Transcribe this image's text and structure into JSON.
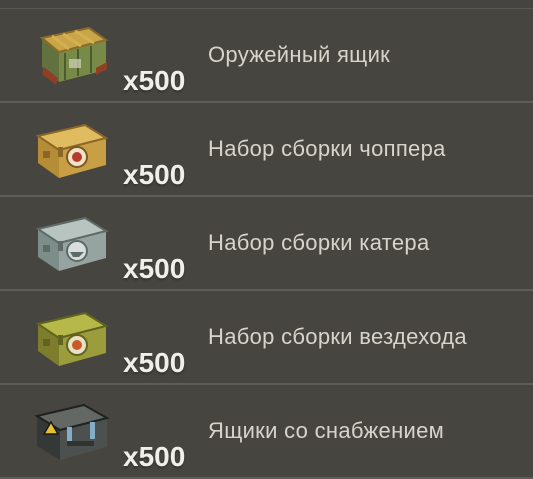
{
  "items": [
    {
      "name": "Оружейный ящик",
      "quantity": "x500",
      "icon": "weapon-crate-icon"
    },
    {
      "name": "Набор сборки чоппера",
      "quantity": "x500",
      "icon": "chopper-kit-box-icon"
    },
    {
      "name": "Набор сборки катера",
      "quantity": "x500",
      "icon": "boat-kit-box-icon"
    },
    {
      "name": "Набор сборки вездехода",
      "quantity": "x500",
      "icon": "atv-kit-box-icon"
    },
    {
      "name": "Ящики со снабжением",
      "quantity": "x500",
      "icon": "supply-case-icon"
    }
  ],
  "colors": {
    "background": "#47453f",
    "divider": "#5f5d57",
    "label": "#d7d4cc",
    "quantity": "#f0efe9"
  }
}
